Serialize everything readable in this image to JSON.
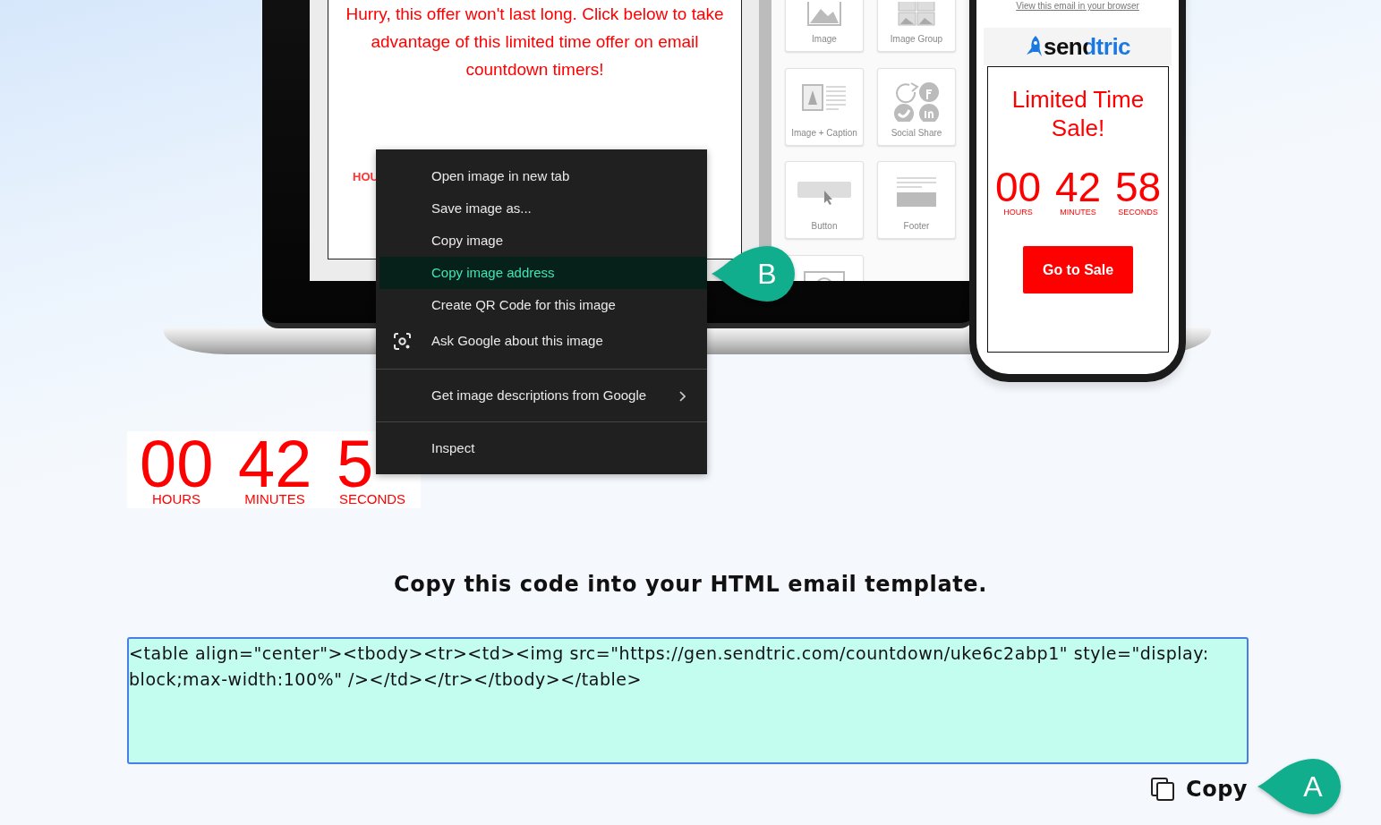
{
  "mockup": {
    "email_preview": {
      "message": "Hurry, this offer won't last long. Click below to take advantage of this limited time offer on email countdown timers!",
      "timer_label": "HOU"
    },
    "builder_blocks": [
      {
        "kind": "image",
        "label": "Image"
      },
      {
        "kind": "image-group",
        "label": "Image Group"
      },
      {
        "kind": "image-caption",
        "label": "Image + Caption"
      },
      {
        "kind": "social",
        "label": "Social Share"
      },
      {
        "kind": "button",
        "label": "Button"
      },
      {
        "kind": "footer",
        "label": "Footer"
      },
      {
        "kind": "video"
      }
    ],
    "phone": {
      "browser_link": "View this email in your browser",
      "logo": "sendtric",
      "title": "Limited Time Sale!",
      "timer": [
        {
          "value": "00",
          "label": "HOURS"
        },
        {
          "value": "42",
          "label": "MINUTES"
        },
        {
          "value": "58",
          "label": "SECONDS"
        }
      ],
      "button": "Go to Sale"
    }
  },
  "countdown_preview": {
    "timer": [
      {
        "value": "00",
        "label": "HOURS"
      },
      {
        "value": "42",
        "label": "MINUTES"
      },
      {
        "value": "5",
        "label": "SECONDS"
      }
    ]
  },
  "instructions": "Copy this code into your HTML email template.",
  "code_box": {
    "value": "<table align=\"center\"><tbody><tr><td><img src=\"https://gen.sendtric.com/countdown/uke6c2abp1\" style=\"display: block;max-width:100%\" /></td></tr></tbody></table>"
  },
  "copy_button": {
    "label": "Copy",
    "callout": "A"
  },
  "context_menu": {
    "callout": "B",
    "groups": [
      {
        "items": [
          {
            "kind": "plain",
            "label": "Open image in new tab",
            "selected": false
          },
          {
            "kind": "plain",
            "label": "Save image as...",
            "selected": false
          },
          {
            "kind": "plain",
            "label": "Copy image",
            "selected": false
          },
          {
            "kind": "plain",
            "label": "Copy image address",
            "selected": true
          },
          {
            "kind": "plain",
            "label": "Create QR Code for this image",
            "selected": false
          },
          {
            "kind": "lens",
            "label": "Ask Google about this image",
            "selected": false
          }
        ]
      },
      {
        "items": [
          {
            "kind": "submenu",
            "label": "Get image descriptions from Google",
            "selected": false
          }
        ]
      },
      {
        "items": [
          {
            "kind": "plain",
            "label": "Inspect",
            "selected": false
          }
        ]
      }
    ]
  }
}
